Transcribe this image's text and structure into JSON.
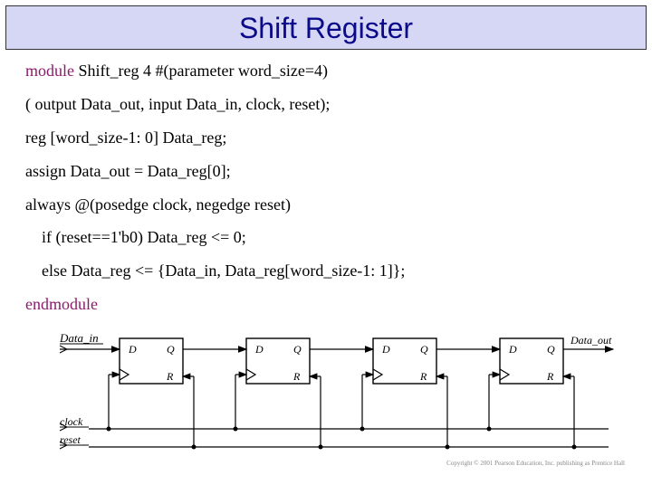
{
  "title": "Shift Register",
  "code": {
    "l1_kw": "module",
    "l1_rest": " Shift_reg 4 #(parameter  word_size=4)",
    "l2": "( output Data_out,  input Data_in, clock, reset);",
    "l3": "reg [word_size-1: 0] Data_reg;",
    "l4": "assign Data_out = Data_reg[0];",
    "l5": "always @(posedge clock, negedge reset)",
    "l6": "if (reset==1'b0)  Data_reg <= 0;",
    "l7": "else Data_reg <= {Data_in, Data_reg[word_size-1: 1]};",
    "l8": "endmodule"
  },
  "diagram": {
    "data_in": "Data_in",
    "data_out": "Data_out",
    "clock": "clock",
    "reset": "reset",
    "D": "D",
    "Q": "Q",
    "R": "R"
  },
  "copyright": "Copyright © 2001 Pearson Education, Inc. publishing as Prentice Hall"
}
